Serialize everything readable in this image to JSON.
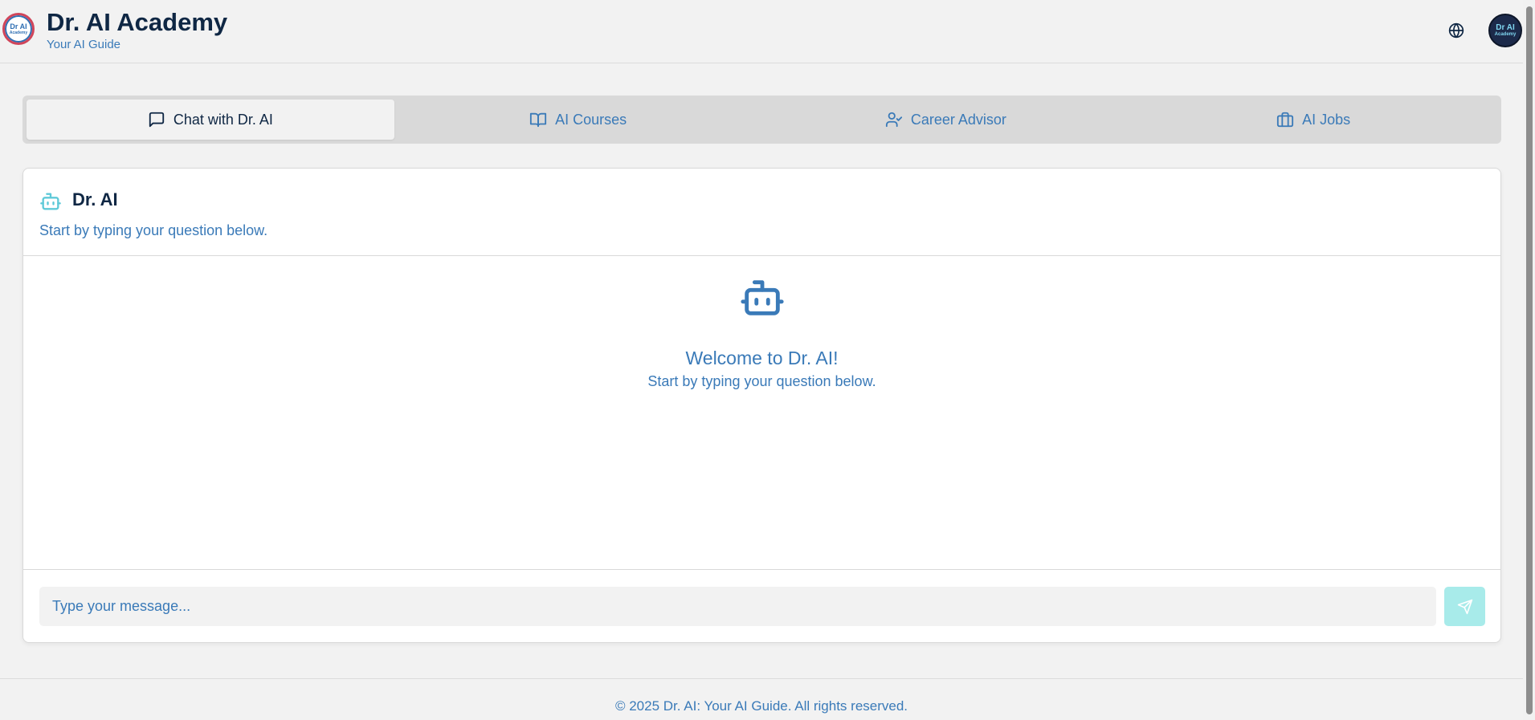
{
  "header": {
    "title": "Dr. AI Academy",
    "subtitle": "Your AI Guide",
    "logo_icon": "dr-ai-academy-logo",
    "language_icon": "globe-icon",
    "avatar_icon": "dr-ai-academy-avatar"
  },
  "tabs": [
    {
      "label": "Chat with Dr. AI",
      "icon": "message-square-icon",
      "active": true
    },
    {
      "label": "AI Courses",
      "icon": "book-open-icon",
      "active": false
    },
    {
      "label": "Career Advisor",
      "icon": "user-check-icon",
      "active": false
    },
    {
      "label": "AI Jobs",
      "icon": "briefcase-icon",
      "active": false
    }
  ],
  "chat": {
    "title": "Dr. AI",
    "description": "Start by typing your question below.",
    "welcome_title": "Welcome to Dr. AI!",
    "welcome_subtitle": "Start by typing your question below.",
    "input_placeholder": "Type your message...",
    "send_icon": "send-icon"
  },
  "footer": {
    "text": "© 2025 Dr. AI: Your AI Guide. All rights reserved."
  },
  "colors": {
    "primary_text": "#0f2744",
    "accent_blue": "#3a7ab8",
    "teal": "#5ec9d8",
    "send_button": "#a8ebea",
    "page_bg": "#f2f2f2"
  }
}
